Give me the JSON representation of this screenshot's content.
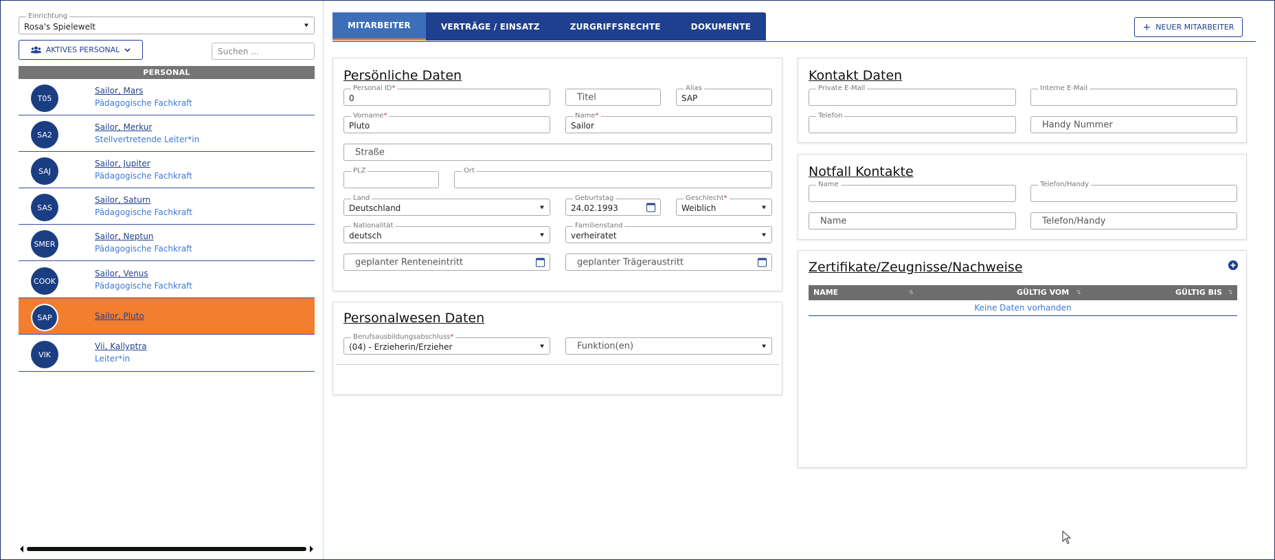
{
  "sidebar": {
    "facility_label": "Einrichtung",
    "facility_value": "Rosa's Spielewelt",
    "filter_button": "AKTIVES PERSONAL",
    "search_placeholder": "Suchen ...",
    "list_header": "PERSONAL",
    "people": [
      {
        "initials": "T05",
        "name": "Sailor, Mars",
        "role": "Pädagogische Fachkraft"
      },
      {
        "initials": "SA2",
        "name": "Sailor, Merkur",
        "role": "Stellvertretende Leiter*in"
      },
      {
        "initials": "SAJ",
        "name": "Sailor, Jupiter",
        "role": "Pädagogische Fachkraft"
      },
      {
        "initials": "SAS",
        "name": "Sailor, Saturn",
        "role": "Pädagogische Fachkraft"
      },
      {
        "initials": "SMER",
        "name": "Sailor, Neptun",
        "role": "Pädagogische Fachkraft"
      },
      {
        "initials": "COOK",
        "name": "Sailor, Venus",
        "role": "Pädagogische Fachkraft"
      },
      {
        "initials": "SAP",
        "name": "Sailor, Pluto",
        "role": ""
      },
      {
        "initials": "VIK",
        "name": "Vii, Kallyptra",
        "role": "Leiter*in"
      }
    ]
  },
  "tabs": [
    "MITARBEITER",
    "VERTRÄGE / EINSATZ",
    "ZURGRIFFSRECHTE",
    "DOKUMENTE"
  ],
  "new_employee_button": "NEUER MITARBEITER",
  "personal": {
    "title": "Persönliche Daten",
    "personal_id_label": "Personal ID",
    "personal_id": "0",
    "titel_placeholder": "Titel",
    "alias_label": "Alias",
    "alias": "SAP",
    "vorname_label": "Vorname",
    "vorname": "Pluto",
    "name_label": "Name",
    "name": "Sailor",
    "strasse_placeholder": "Straße",
    "plz_label": "PLZ",
    "ort_label": "Ort",
    "land_label": "Land",
    "land": "Deutschland",
    "geburtstag_label": "Geburtstag",
    "geburtstag": "24.02.1993",
    "geschlecht_label": "Geschlecht",
    "geschlecht": "Weiblich",
    "nationalitaet_label": "Nationalität",
    "nationalitaet": "deutsch",
    "familienstand_label": "Familienstand",
    "familienstand": "verheiratet",
    "rente_placeholder": "geplanter Renteneintritt",
    "traeger_placeholder": "geplanter Trägeraustritt"
  },
  "personalwesen": {
    "title": "Personalwesen Daten",
    "ausbildung_label": "Berufsausbildungsabschluss",
    "ausbildung": "(04) - Erzieherin/Erzieher",
    "funktion_placeholder": "Funktion(en)"
  },
  "kontakt": {
    "title": "Kontakt Daten",
    "private_email_label": "Private E-Mail",
    "interne_email_label": "Interne E-Mail",
    "telefon_label": "Telefon",
    "handy_placeholder": "Handy Nummer"
  },
  "notfall": {
    "title": "Notfall Kontakte",
    "name_label": "Name",
    "telefon_label": "Telefon/Handy",
    "name_placeholder": "Name",
    "telefon_placeholder": "Telefon/Handy"
  },
  "zertifikate": {
    "title": "Zertifikate/Zeugnisse/Nachweise",
    "columns": [
      "NAME",
      "GÜLTIG VOM",
      "GÜLTIG BIS"
    ],
    "empty": "Keine Daten vorhanden"
  },
  "colors": {
    "accent": "#1f3f8f",
    "active": "#f37e2f",
    "avatar": "#1b3e83"
  }
}
